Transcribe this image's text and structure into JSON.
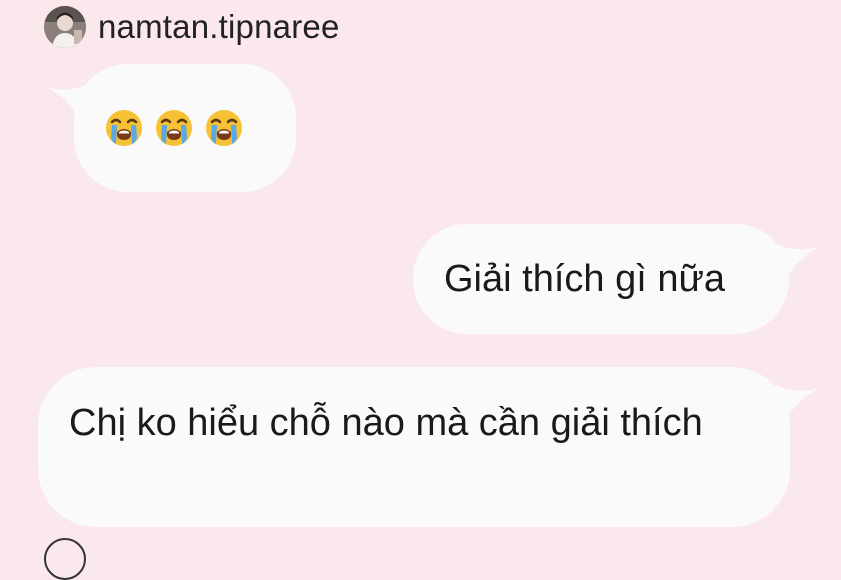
{
  "sender": {
    "username": "namtan.tipnaree",
    "avatar_icon": "profile-photo"
  },
  "messages": [
    {
      "id": "msg-1",
      "side": "left",
      "emojis": [
        "loudly-crying-face-emoji",
        "loudly-crying-face-emoji",
        "loudly-crying-face-emoji"
      ]
    },
    {
      "id": "msg-2",
      "side": "right",
      "text": "Giải thích gì nữa"
    },
    {
      "id": "msg-3",
      "side": "left",
      "text": "Chị ko hiểu chỗ nào mà cần giải thích"
    }
  ],
  "colors": {
    "background": "#fbe8ec",
    "bubble": "#fafafa",
    "text": "#1a1a1a"
  }
}
